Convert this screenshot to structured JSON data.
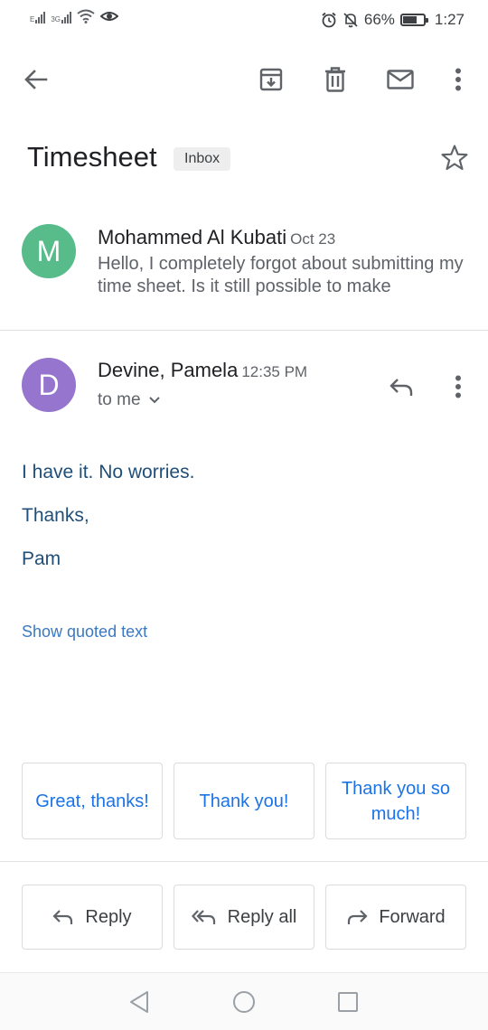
{
  "status_bar": {
    "net_left_tag": "E",
    "net_right_tag": "3G",
    "battery": "66%",
    "time": "1:27"
  },
  "toolbar": {
    "icons": [
      "back-arrow-icon",
      "archive-icon",
      "delete-icon",
      "mark-unread-icon",
      "more-vert-icon"
    ]
  },
  "thread": {
    "subject": "Timesheet",
    "label": "Inbox"
  },
  "messages": [
    {
      "avatar_letter": "M",
      "avatar_color": "#57bb8a",
      "sender": "Mohammed Al Kubati",
      "date": "Oct 23",
      "snippet": "Hello, I completely forgot about submitting my time sheet. Is it still possible to make"
    },
    {
      "avatar_letter": "D",
      "avatar_color": "#9575cd",
      "sender": "Devine, Pamela",
      "date": "12:35 PM",
      "recipients": "to me",
      "body": [
        "I have it. No worries.",
        "Thanks,",
        "Pam"
      ],
      "show_quoted": "Show quoted text"
    }
  ],
  "smart_replies": [
    "Great, thanks!",
    "Thank you!",
    "Thank you so much!"
  ],
  "actions": {
    "reply": "Reply",
    "reply_all": "Reply all",
    "forward": "Forward"
  },
  "colors": {
    "accent": "#1a73e8",
    "body_text": "#1f4e79",
    "link": "#3b78c2"
  }
}
